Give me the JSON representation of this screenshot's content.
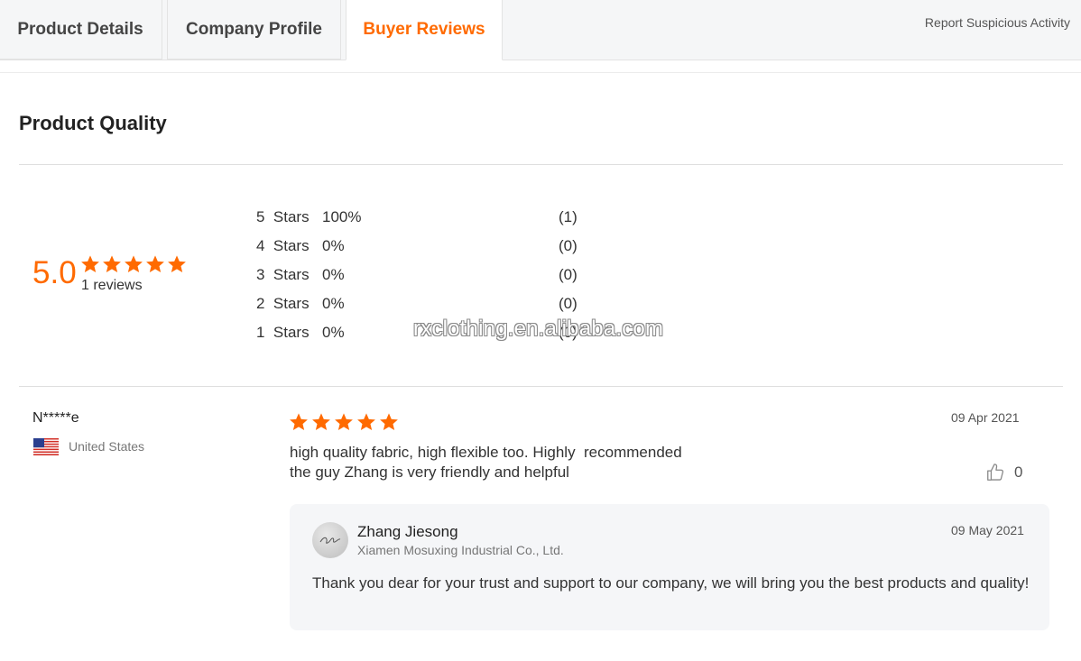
{
  "tabs": [
    {
      "label": "Product Details"
    },
    {
      "label": "Company Profile"
    },
    {
      "label": "Buyer Reviews"
    }
  ],
  "header": {
    "report_link": "Report Suspicious Activity"
  },
  "quality": {
    "title": "Product Quality",
    "score": "5.0",
    "reviews_count": "1 reviews",
    "rating_stars": 5,
    "distribution": [
      {
        "label": "5  Stars",
        "percent": "100%",
        "count": "(1)"
      },
      {
        "label": "4  Stars",
        "percent": "0%",
        "count": "(0)"
      },
      {
        "label": "3  Stars",
        "percent": "0%",
        "count": "(0)"
      },
      {
        "label": "2  Stars",
        "percent": "0%",
        "count": "(0)"
      },
      {
        "label": "1  Stars",
        "percent": "0%",
        "count": "(0)"
      }
    ]
  },
  "watermark": "rxclothing.en.alibaba.com",
  "review": {
    "reviewer": "N*****e",
    "country": "United States",
    "rating_stars": 5,
    "date": "09 Apr 2021",
    "text_line1": "high quality fabric, high flexible too. Highly  recommended",
    "text_line2": "the guy Zhang is very friendly and helpful",
    "likes": "0",
    "reply": {
      "name": "Zhang Jiesong",
      "company": "Xiamen Mosuxing Industrial Co., Ltd.",
      "date": "09 May 2021",
      "text": "Thank you dear for your trust and support to our company, we will bring you the best products and quality!"
    }
  },
  "colors": {
    "accent": "#ff6a00",
    "reply_bg": "#f5f6f8"
  },
  "icons": [
    "star-icon",
    "thumbs-up-icon",
    "us-flag-icon",
    "avatar"
  ]
}
